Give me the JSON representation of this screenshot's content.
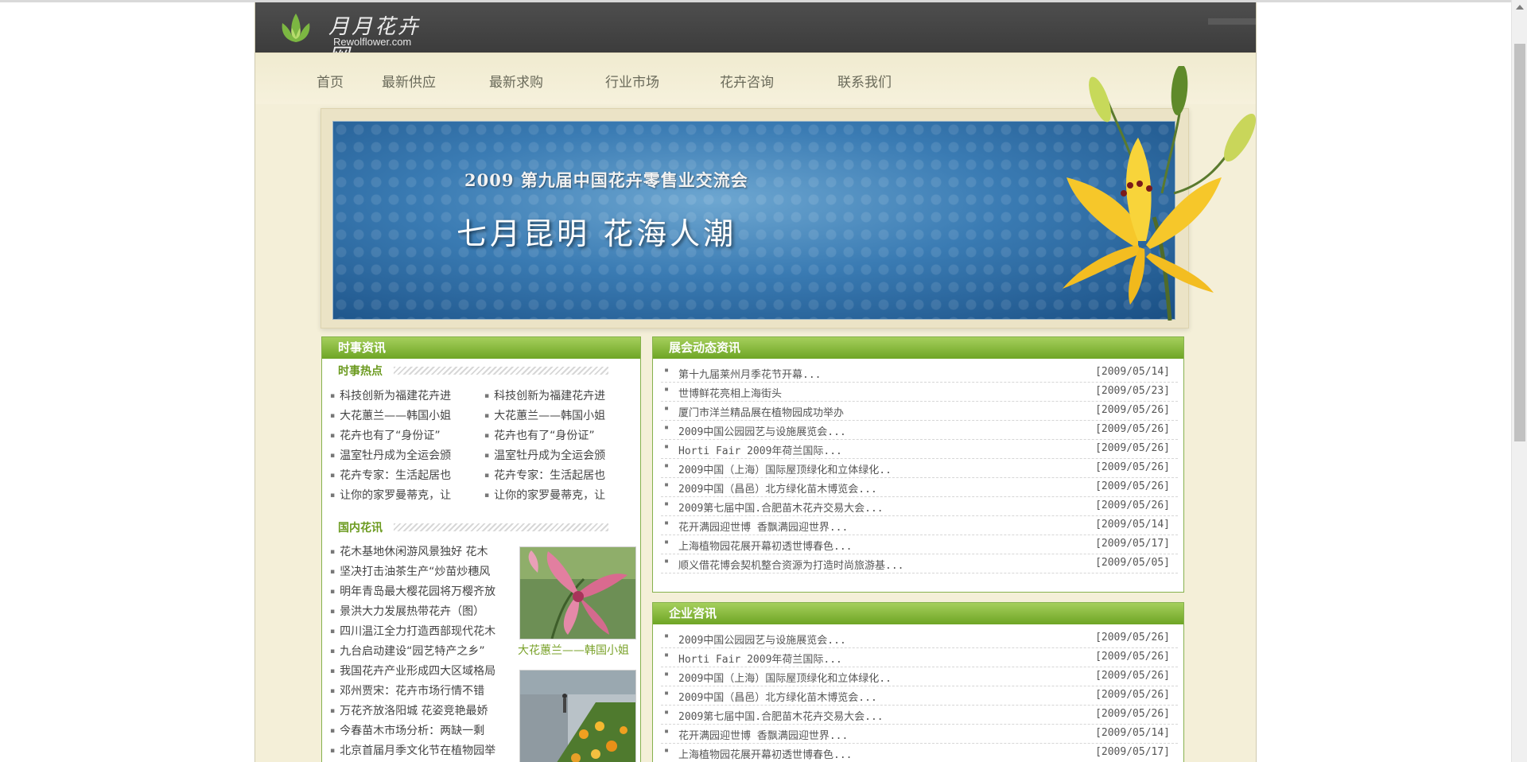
{
  "logo": {
    "cn": "月月花卉网",
    "en": "Rewolflower.com"
  },
  "nav": [
    "首页",
    "最新供应",
    "最新求购",
    "行业市场",
    "花卉咨询",
    "联系我们"
  ],
  "banner": {
    "subtitle": "2009 第九届中国花卉零售业交流会",
    "title": "七月昆明  花海人潮"
  },
  "left_box": {
    "title": "时事资讯",
    "hot": {
      "title": "时事热点",
      "col1": [
        "科技创新为福建花卉进",
        "大花蕙兰——韩国小姐",
        "花卉也有了“身份证”",
        "温室牡丹成为全运会颁",
        "花卉专家：生活起居也",
        "让你的家罗曼蒂克，让"
      ],
      "col2": [
        "科技创新为福建花卉进",
        "大花蕙兰——韩国小姐",
        "花卉也有了“身份证”",
        "温室牡丹成为全运会颁",
        "花卉专家：生活起居也",
        "让你的家罗曼蒂克，让"
      ]
    },
    "domestic": {
      "title": "国内花讯",
      "items": [
        "花木基地休闲游风景独好 花木",
        "坚决打击油茶生产“炒苗炒穗风",
        "明年青岛最大樱花园将万樱齐放",
        "景洪大力发展热带花卉（图）",
        "四川温江全力打造西部现代花木",
        "九台启动建设“园艺特产之乡”",
        "我国花卉产业形成四大区域格局",
        "邓州贾宋：花卉市场行情不错",
        "万花齐放洛阳城 花姿竞艳最娇",
        "今春苗木市场分析：两缺一剩",
        "北京首届月季文化节在植物园举"
      ],
      "photo_caption": "大花蕙兰——韩国小姐"
    }
  },
  "expo_box": {
    "title": "展会动态资讯",
    "rows": [
      {
        "title": "第十九届莱州月季花节开幕...",
        "date": "[2009/05/14]"
      },
      {
        "title": "世博鲜花亮相上海街头",
        "date": "[2009/05/23]"
      },
      {
        "title": "厦门市洋兰精品展在植物园成功举办",
        "date": "[2009/05/26]"
      },
      {
        "title": "2009中国公园园艺与设施展览会...",
        "date": "[2009/05/26]"
      },
      {
        "title": "Horti Fair 2009年荷兰国际...",
        "date": "[2009/05/26]"
      },
      {
        "title": "2009中国（上海）国际屋顶绿化和立体绿化..",
        "date": "[2009/05/26]"
      },
      {
        "title": "2009中国（昌邑）北方绿化苗木博览会...",
        "date": "[2009/05/26]"
      },
      {
        "title": "2009第七届中国.合肥苗木花卉交易大会...",
        "date": "[2009/05/26]"
      },
      {
        "title": "花开满园迎世博 香飘满园迎世界...",
        "date": "[2009/05/14]"
      },
      {
        "title": "上海植物园花展开幕初透世博春色...",
        "date": "[2009/05/17]"
      },
      {
        "title": "顺义借花博会契机整合资源为打造时尚旅游基...",
        "date": "[2009/05/05]"
      }
    ]
  },
  "corp_box": {
    "title": "企业咨讯",
    "rows": [
      {
        "title": "2009中国公园园艺与设施展览会...",
        "date": "[2009/05/26]"
      },
      {
        "title": "Horti Fair 2009年荷兰国际...",
        "date": "[2009/05/26]"
      },
      {
        "title": "2009中国（上海）国际屋顶绿化和立体绿化..",
        "date": "[2009/05/26]"
      },
      {
        "title": "2009中国（昌邑）北方绿化苗木博览会...",
        "date": "[2009/05/26]"
      },
      {
        "title": "2009第七届中国.合肥苗木花卉交易大会...",
        "date": "[2009/05/26]"
      },
      {
        "title": "花开满园迎世博 香飘满园迎世界...",
        "date": "[2009/05/14]"
      },
      {
        "title": "上海植物园花展开幕初透世博春色...",
        "date": "[2009/05/17]"
      }
    ]
  }
}
